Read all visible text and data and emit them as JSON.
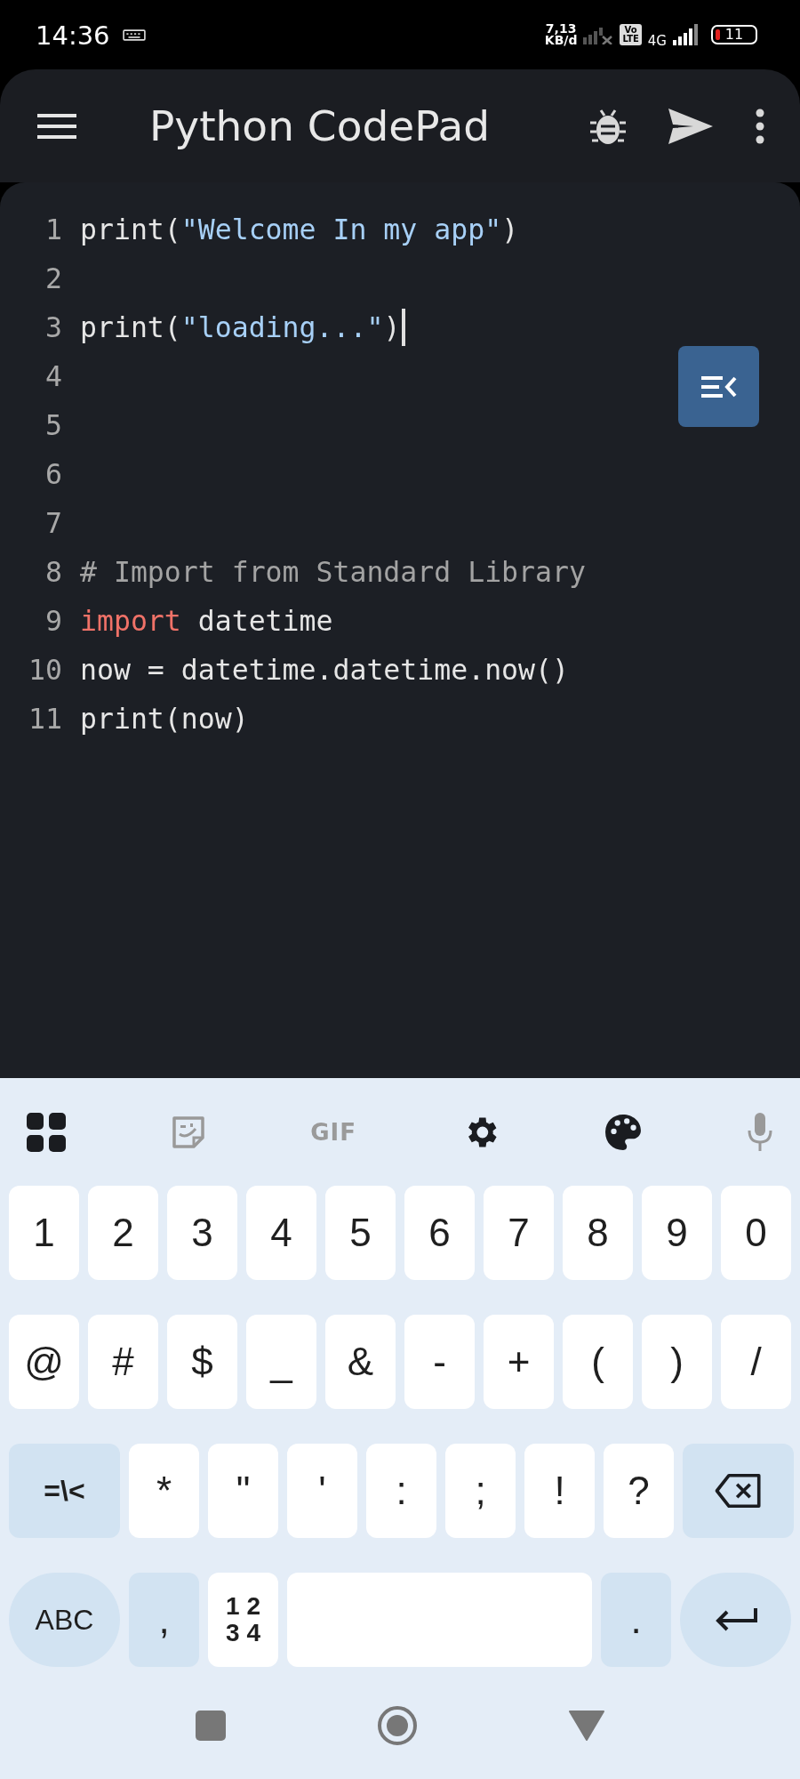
{
  "status_bar": {
    "time": "14:36",
    "data_rate": [
      "7,13",
      "KB/d"
    ],
    "volte": [
      "Vo",
      "LTE"
    ],
    "network": "4G",
    "battery": "11"
  },
  "app_bar": {
    "title": "Python CodePad"
  },
  "editor": {
    "lines": [
      {
        "number": "1",
        "cursor": false,
        "tokens": [
          {
            "text": "print(",
            "kind": "plain"
          },
          {
            "text": "\"Welcome In my app\"",
            "kind": "string"
          },
          {
            "text": ")",
            "kind": "plain"
          }
        ]
      },
      {
        "number": "2",
        "cursor": false
      },
      {
        "number": "3",
        "cursor": true,
        "tokens": [
          {
            "text": "print(",
            "kind": "plain"
          },
          {
            "text": "\"loading...\"",
            "kind": "string"
          },
          {
            "text": ")",
            "kind": "plain"
          }
        ]
      },
      {
        "number": "4",
        "cursor": false
      },
      {
        "number": "5",
        "cursor": false
      },
      {
        "number": "6",
        "cursor": false
      },
      {
        "number": "7",
        "cursor": false
      },
      {
        "number": "8",
        "cursor": false,
        "tokens": [
          {
            "text": "# Import from Standard Library",
            "kind": "comment"
          }
        ]
      },
      {
        "number": "9",
        "cursor": false,
        "tokens": [
          {
            "text": "import",
            "kind": "keyword"
          },
          {
            "text": " datetime",
            "kind": "plain"
          }
        ]
      },
      {
        "number": "10",
        "cursor": false,
        "tokens": [
          {
            "text": "now = datetime.datetime.now()",
            "kind": "plain"
          }
        ]
      },
      {
        "number": "11",
        "cursor": false,
        "tokens": [
          {
            "text": "print(now)",
            "kind": "plain"
          }
        ]
      }
    ]
  },
  "keyboard": {
    "toolbar_gif": "GIF",
    "rows": [
      [
        {
          "kind": "key",
          "label": "1"
        },
        {
          "kind": "key",
          "label": "2"
        },
        {
          "kind": "key",
          "label": "3"
        },
        {
          "kind": "key",
          "label": "4"
        },
        {
          "kind": "key",
          "label": "5"
        },
        {
          "kind": "key",
          "label": "6"
        },
        {
          "kind": "key",
          "label": "7"
        },
        {
          "kind": "key",
          "label": "8"
        },
        {
          "kind": "key",
          "label": "9"
        },
        {
          "kind": "key",
          "label": "0"
        }
      ],
      [
        {
          "kind": "key",
          "label": "@"
        },
        {
          "kind": "key",
          "label": "#"
        },
        {
          "kind": "key",
          "label": "$"
        },
        {
          "kind": "key",
          "label": "_"
        },
        {
          "kind": "key",
          "label": "&"
        },
        {
          "kind": "key",
          "label": "-"
        },
        {
          "kind": "key",
          "label": "+"
        },
        {
          "kind": "key",
          "label": "("
        },
        {
          "kind": "key",
          "label": ")"
        },
        {
          "kind": "key",
          "label": "/"
        }
      ],
      [
        {
          "kind": "wide",
          "label": "=\\<"
        },
        {
          "kind": "key",
          "label": "*"
        },
        {
          "kind": "key",
          "label": "\""
        },
        {
          "kind": "key",
          "label": "'"
        },
        {
          "kind": "key",
          "label": ":"
        },
        {
          "kind": "key",
          "label": ";"
        },
        {
          "kind": "key",
          "label": "!"
        },
        {
          "kind": "key",
          "label": "?"
        },
        {
          "kind": "backspace"
        }
      ],
      [
        {
          "kind": "pill",
          "label": "ABC"
        },
        {
          "kind": "mod",
          "label": ","
        },
        {
          "kind": "numpad",
          "lines": [
            "1 2",
            "3 4"
          ]
        },
        {
          "kind": "space"
        },
        {
          "kind": "mod",
          "label": "."
        },
        {
          "kind": "enter"
        }
      ]
    ]
  }
}
